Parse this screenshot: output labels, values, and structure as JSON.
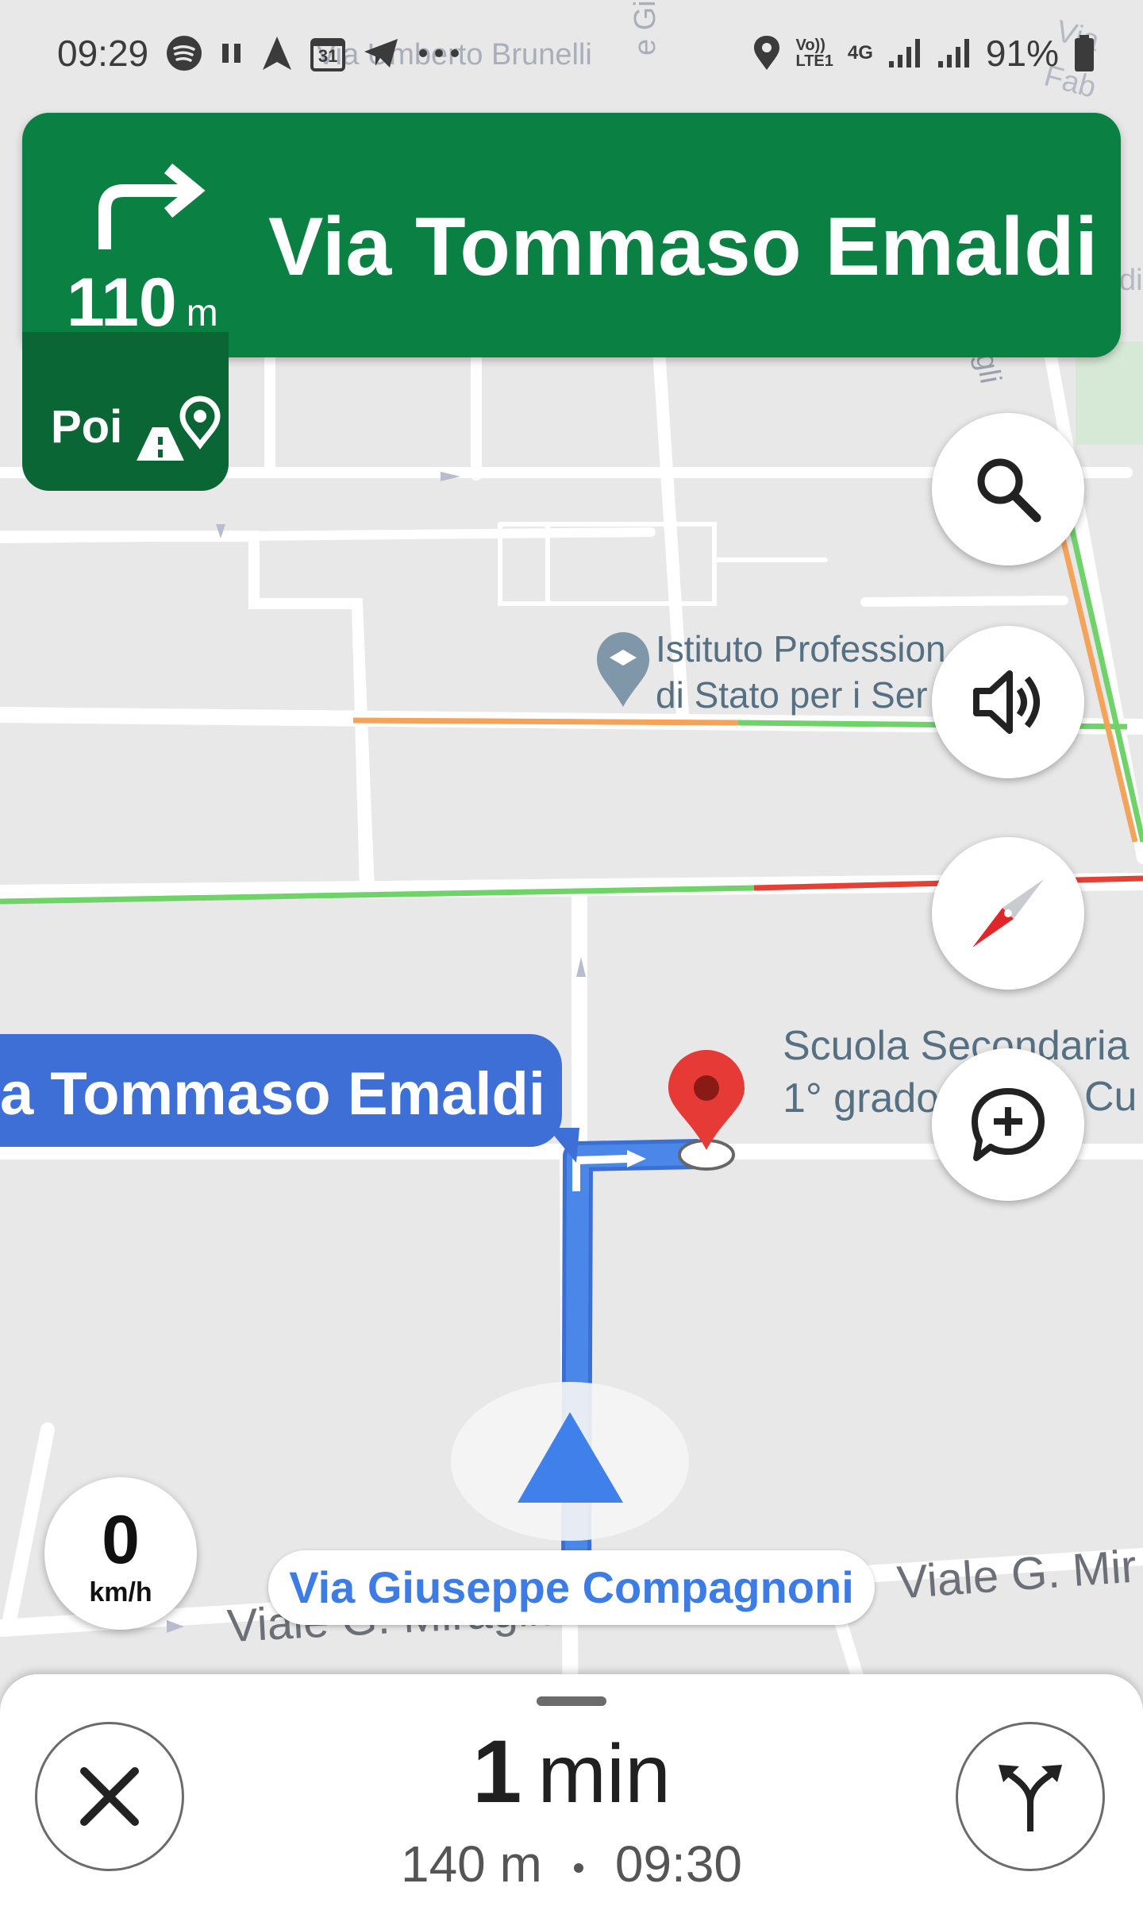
{
  "status_bar": {
    "time": "09:29",
    "battery": "91%",
    "network": "4G",
    "volte": "Vo))\nLTE1",
    "icons": [
      "spotify-icon",
      "pause-icon",
      "navigation-icon",
      "calendar-icon",
      "telegram-icon",
      "more-dots-icon",
      "location-icon",
      "signal-icon",
      "signal-icon",
      "battery-icon"
    ]
  },
  "calendar_day": "31",
  "navigation": {
    "maneuver": "turn-right-icon",
    "distance_value": "110",
    "distance_unit": "m",
    "street": "Via Tommaso Emaldi",
    "then_label": "Poi",
    "then_icon": "destination-icon"
  },
  "map": {
    "labels": {
      "umberto": "Via Umberto Brunelli",
      "giacomo": "e Giacor",
      "fab": "Via Fab",
      "di": "di",
      "gli": "gli",
      "istituto_line1": "Istituto Profession",
      "istituto_line2": "di Stato per i Ser",
      "scuola_line1": "Scuola Secondaria",
      "scuola_line2": "1° grado",
      "scuola_tail": "Cu",
      "viale_left": "Viale G. Miraglia",
      "viale_right": "Viale G. Mir"
    },
    "route_callout": "a Tommaso Emaldi",
    "current_street": "Via Giuseppe Compagnoni",
    "speed_value": "0",
    "speed_unit": "km/h"
  },
  "controls": {
    "search": "search-icon",
    "sound": "volume-icon",
    "compass": "compass-icon",
    "report": "add-report-icon"
  },
  "trip": {
    "eta_value": "1",
    "eta_unit": "min",
    "distance": "140 m",
    "arrival": "09:30"
  },
  "colors": {
    "header_green": "#0b8043",
    "then_green": "#0a6634",
    "route_blue": "#4a87e8",
    "callout_blue": "#3d6fd6",
    "traffic_green": "#6fd36a",
    "traffic_orange": "#f4a35a",
    "traffic_red": "#e34136",
    "pin_red": "#e53a35"
  }
}
